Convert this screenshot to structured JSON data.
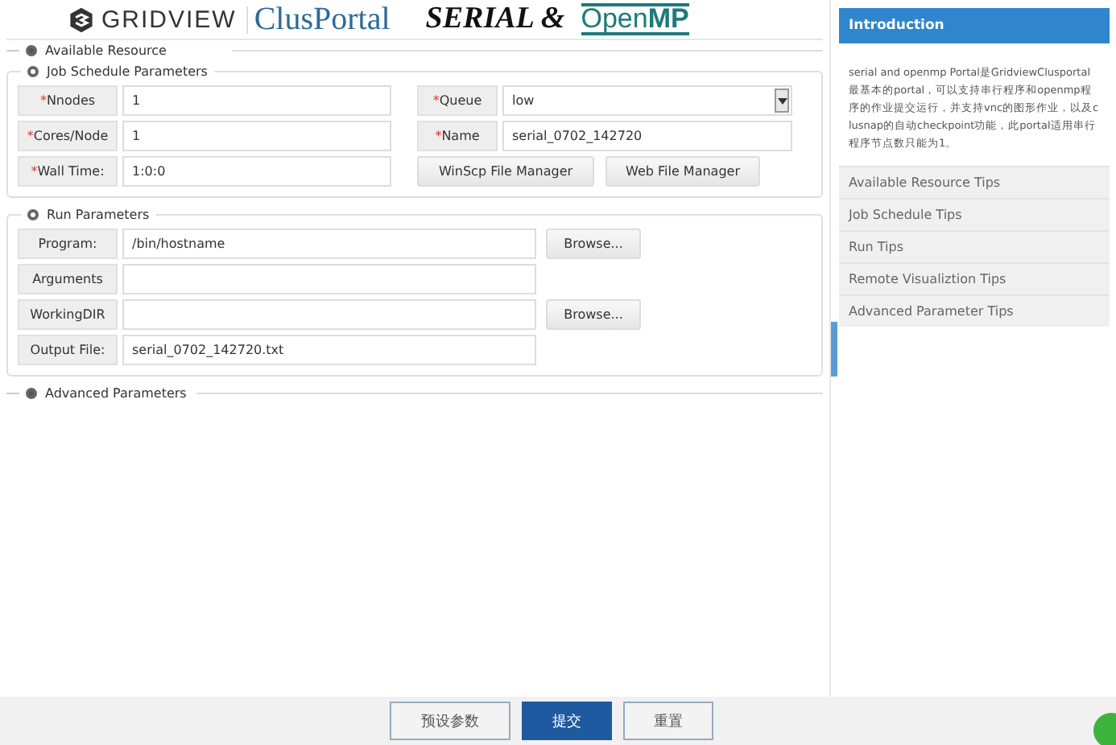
{
  "header": {
    "brand": "GRIDVIEW",
    "product": "ClusPortal",
    "title": "SERIAL &",
    "title_logo": "Open**MP**"
  },
  "available_resource": {
    "title": "Available Resource",
    "expanded": false
  },
  "job_schedule": {
    "title": "Job Schedule Parameters",
    "expanded": true,
    "left_fields": [
      {
        "mark": "*",
        "label": "Nnodes",
        "value": "1"
      },
      {
        "mark": "*",
        "label": "Cores/Node",
        "value": "1"
      },
      {
        "mark": "*",
        "label": "Wall Time:",
        "value": "1:0:0"
      }
    ],
    "right_fields": [
      {
        "mark": "*",
        "label": "Queue",
        "value": "low",
        "kind": "select"
      },
      {
        "mark": "*",
        "label": "Name",
        "value": "serial_0702_142720",
        "kind": "text"
      }
    ],
    "buttons": [
      "WinScp File Manager",
      "Web File Manager"
    ]
  },
  "run_parameters": {
    "title": "Run Parameters",
    "expanded": true,
    "fields": [
      {
        "label": "Program:",
        "value": "/bin/hostname",
        "browse": "Browse..."
      },
      {
        "label": "Arguments"
      },
      {
        "label": "WorkingDIR",
        "browse": "Browse..."
      },
      {
        "label": "Output File:",
        "value": "serial_0702_142720.txt"
      }
    ]
  },
  "advanced_parameters": {
    "title": "Advanced Parameters",
    "expanded": false
  },
  "footer_buttons": [
    {
      "label": "预设参数",
      "primary": false
    },
    {
      "label": "提交",
      "primary": true
    },
    {
      "label": "重置",
      "primary": false
    }
  ],
  "sidebar": {
    "title": "Introduction",
    "text": "serial and openmp Portal是GridviewClusportal最基本的portal，可以支持串行程序和openmp程序的作业提交运行，并支持vnc的图形作业，以及clusnap的自动checkpoint功能，此portal适用串行程序节点数只能为1。",
    "tips": [
      "Available Resource Tips",
      "Job Schedule Tips",
      "Run Tips",
      "Remote Visualiztion Tips",
      "Advanced Parameter Tips"
    ]
  }
}
